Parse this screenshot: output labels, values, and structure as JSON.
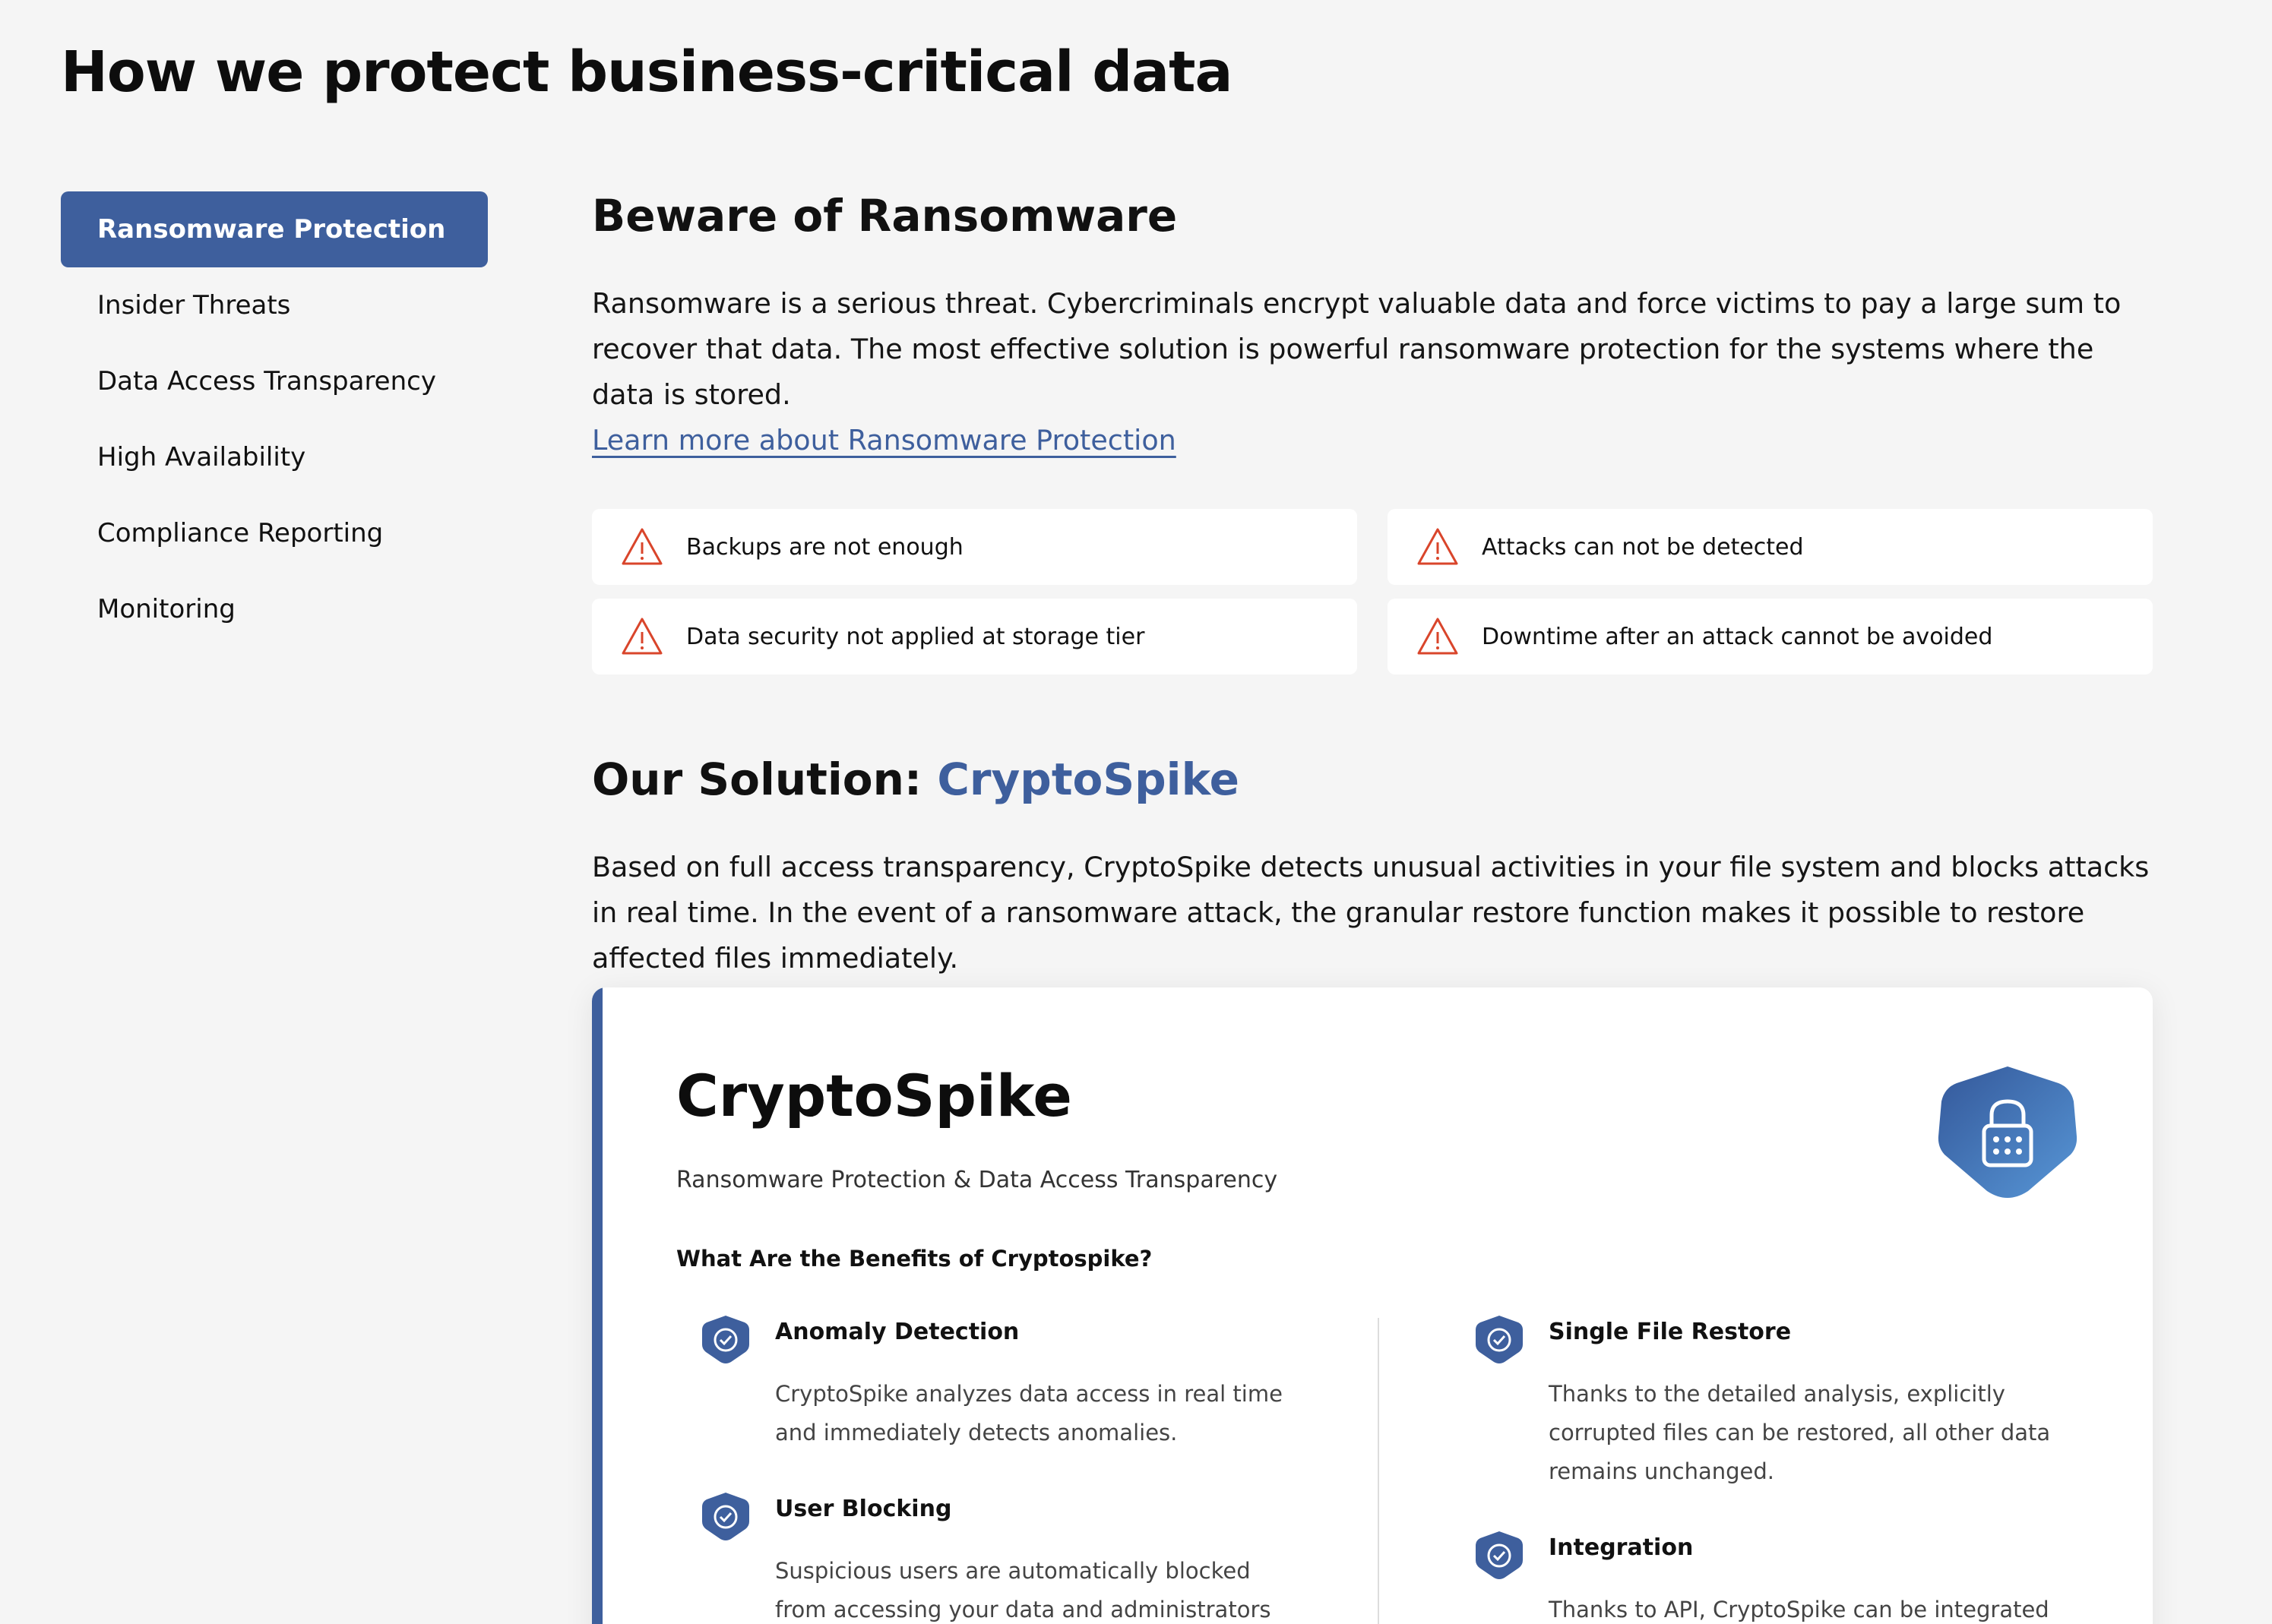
{
  "page": {
    "title": "How we protect business-critical data"
  },
  "sidebar": {
    "items": [
      {
        "label": "Ransomware Protection"
      },
      {
        "label": "Insider Threats"
      },
      {
        "label": "Data Access Transparency"
      },
      {
        "label": "High Availability"
      },
      {
        "label": "Compliance Reporting"
      },
      {
        "label": "Monitoring"
      }
    ]
  },
  "beware": {
    "heading": "Beware of Ransomware",
    "text": "Ransomware is a serious threat. Cybercriminals encrypt valuable data and force victims to pay a large sum to recover that data. The most effective solution is powerful ransomware protection for the systems where the data is stored.",
    "link": "Learn more about Ransomware Protection",
    "warnings": [
      {
        "text": "Backups are not enough",
        "icon": "warning-triangle-icon"
      },
      {
        "text": "Attacks can not be detected",
        "icon": "warning-triangle-icon"
      },
      {
        "text": "Data security not applied at storage tier",
        "icon": "warning-triangle-icon"
      },
      {
        "text": "Downtime after an attack cannot be avoided",
        "icon": "warning-triangle-icon"
      }
    ]
  },
  "solution": {
    "heading_prefix": "Our Solution: ",
    "heading_highlight": "CryptoSpike",
    "text": "Based on full access transparency, CryptoSpike detects unusual activities in your file system and blocks attacks in real time. In the event of a ransomware attack, the granular restore function makes it possible to restore affected files immediately."
  },
  "product": {
    "name": "CryptoSpike",
    "subtitle": "Ransomware Protection & Data Access Transparency",
    "logo_icon": "lock-icon",
    "benefits_heading": "What Are the Benefits of Cryptospike?",
    "benefits": [
      {
        "title": "Anomaly Detection",
        "text": "CryptoSpike analyzes data access in real time and immediately detects anomalies."
      },
      {
        "title": "User Blocking",
        "text": "Suspicious users are automatically blocked from accessing your data and administrators are"
      },
      {
        "title": "Single File Restore",
        "text": "Thanks to the detailed analysis, explicitly corrupted files can be restored, all other data remains unchanged."
      },
      {
        "title": "Integration",
        "text": "Thanks to API, CryptoSpike can be integrated with"
      }
    ]
  },
  "colors": {
    "accent": "#3e5f9d",
    "warning": "#d9452b",
    "background": "#f5f5f5"
  }
}
